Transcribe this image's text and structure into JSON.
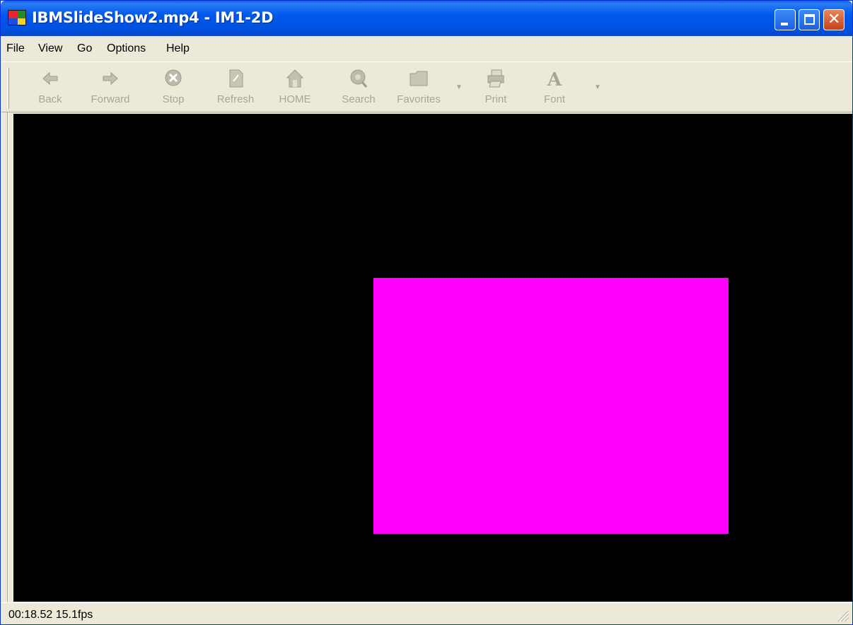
{
  "window": {
    "title": "IBMSlideShow2.mp4 - IM1-2D"
  },
  "menu": [
    "File",
    "View",
    "Go",
    "Options",
    "Help"
  ],
  "toolbar": {
    "back": "Back",
    "forward": "Forward",
    "stop": "Stop",
    "refresh": "Refresh",
    "home": "HOME",
    "search": "Search",
    "favorites": "Favorites",
    "print": "Print",
    "font": "Font"
  },
  "status": {
    "text": "00:18.52 15.1fps"
  },
  "colors": {
    "title_blue": "#0058ee",
    "video_bg": "#000000",
    "slide_color": "#ff00ff",
    "disabled_text": "#a8a596"
  }
}
